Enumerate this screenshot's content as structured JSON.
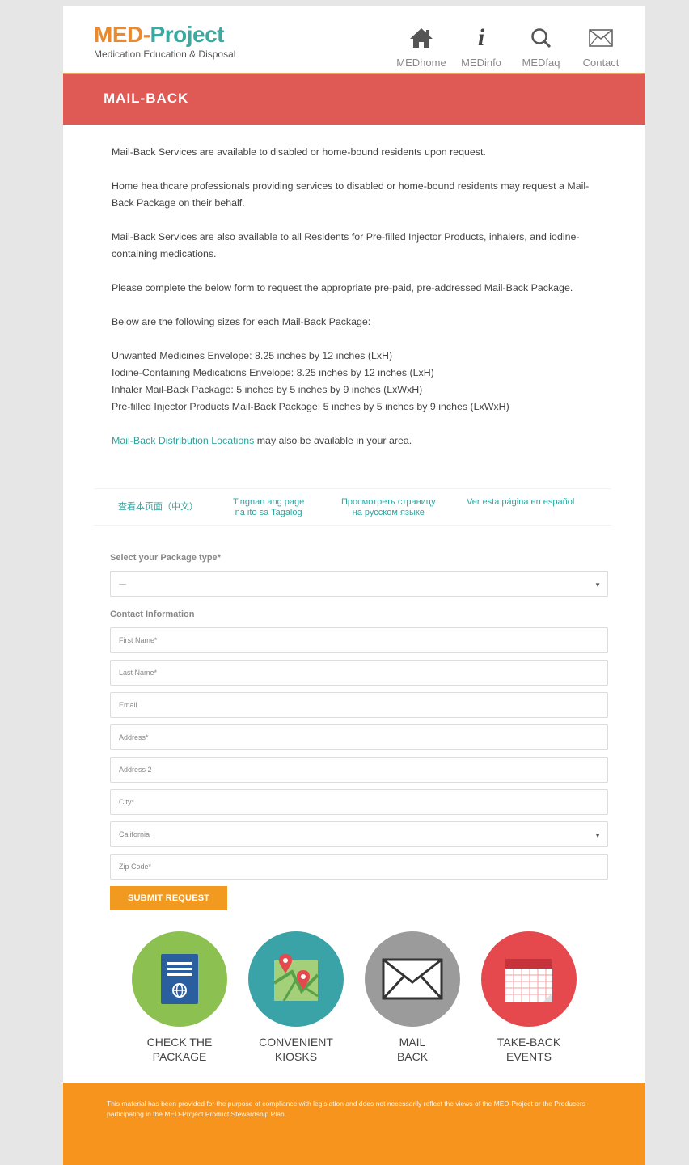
{
  "header": {
    "logo_med": "MED-",
    "logo_project": "Project",
    "logo_subtitle": "Medication Education & Disposal",
    "nav": [
      {
        "label": "MEDhome",
        "icon": "home-icon"
      },
      {
        "label": "MEDinfo",
        "icon": "info-icon"
      },
      {
        "label": "MEDfaq",
        "icon": "search-icon"
      },
      {
        "label": "Contact",
        "icon": "mail-icon"
      }
    ]
  },
  "banner": {
    "title": "MAIL-BACK"
  },
  "content": {
    "p1": "Mail-Back Services are available to disabled or home-bound residents upon request.",
    "p2": "Home healthcare professionals providing services to disabled or home-bound residents may request a Mail-Back Package on their behalf.",
    "p3": "Mail-Back Services are also available to all Residents for Pre-filled Injector Products, inhalers, and iodine-containing medications.",
    "p4": "Please complete the below form to request the appropriate pre-paid, pre-addressed Mail-Back Package.",
    "p5": "Below are the following sizes for each Mail-Back Package:",
    "sizes": [
      "Unwanted Medicines Envelope: 8.25 inches by 12 inches (LxH)",
      "Iodine-Containing Medications Envelope:  8.25 inches by 12 inches (LxH)",
      "Inhaler Mail-Back Package: 5 inches by 5 inches by 9 inches (LxWxH)",
      "Pre-filled Injector Products Mail-Back Package: 5 inches by 5 inches by 9 inches (LxWxH)"
    ],
    "locations_link": "Mail-Back Distribution Locations",
    "locations_tail": " may also be available in your area."
  },
  "languages": [
    {
      "line1": "查看本页面（中文）",
      "line2": ""
    },
    {
      "line1": "Tingnan ang page",
      "line2": "na ito sa Tagalog"
    },
    {
      "line1": "Просмотреть страницу",
      "line2": "на русском языке"
    },
    {
      "line1": "Ver esta página en español",
      "line2": ""
    }
  ],
  "form": {
    "package_label": "Select your Package type*",
    "package_value": "—",
    "contact_label": "Contact Information",
    "first_name": "First Name*",
    "last_name": "Last Name*",
    "email": "Email",
    "address": "Address*",
    "address2": "Address 2",
    "city": "City*",
    "state_value": "California",
    "zip": "Zip Code*",
    "submit": "SUBMIT REQUEST"
  },
  "icons": [
    {
      "line1": "CHECK THE",
      "line2": "PACKAGE",
      "color": "#8cc152"
    },
    {
      "line1": "CONVENIENT",
      "line2": "KIOSKS",
      "color": "#3aa3a8"
    },
    {
      "line1": "MAIL",
      "line2": "BACK",
      "color": "#9b9b9b"
    },
    {
      "line1": "TAKE-BACK",
      "line2": "EVENTS",
      "color": "#e5484d"
    }
  ],
  "footer": {
    "text": "This material has been provided for the purpose of compliance with legislation and does not necessarily reflect the views of the MED-Project or the Producers participating in the MED-Project Product Stewardship Plan."
  },
  "colors": {
    "banner": "#e05a55",
    "accent_orange": "#f7941d",
    "teal_link": "#2aa5a0"
  }
}
